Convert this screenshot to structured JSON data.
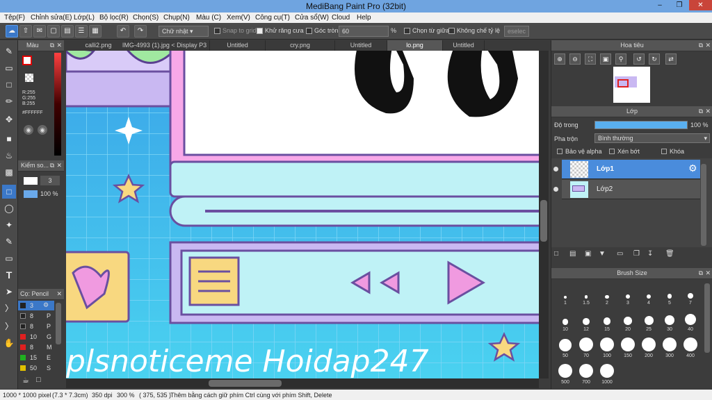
{
  "window": {
    "title": "MediBang Paint Pro (32bit)"
  },
  "menu": [
    "Tệp(F)",
    "Chỉnh sửa(E)",
    "Lớp(L)",
    "Bộ lọc(R)",
    "Chọn(S)",
    "Chụp(N)",
    "Màu (C)",
    "Xem(V)",
    "Công cụ(T)",
    "Cửa sổ(W)",
    "Cloud",
    "Help"
  ],
  "toolbar": {
    "shape_select": "Chữ nhật",
    "snap_label": "Snap to grid",
    "antialias_label": "Khử răng cưa",
    "corner_label": "Góc tròn",
    "corner_value": "60",
    "percent": "%",
    "center_label": "Chọn từ giữa",
    "ratio_label": "Không chế tỷ lệ",
    "deselect_label": "eselec"
  },
  "tabs": [
    "calli2.png",
    "IMG-4993 (1).jpg < Display P3 >",
    "Untitled",
    "cry.png",
    "Untitled",
    "lo.png",
    "Untitled"
  ],
  "color_panel": {
    "title": "Màu",
    "r": "R:255",
    "g": "G:255",
    "b": "B:255",
    "hex": "#FFFFFF",
    "fg": "#ffffff",
    "bg": "#e00000"
  },
  "brush_ctrl": {
    "title": "Kiểm so...",
    "size": "3",
    "opacity": "100 %"
  },
  "brush_list": {
    "title": "Cọ: Pencil",
    "items": [
      {
        "size": "3",
        "name": "",
        "color": "#222222"
      },
      {
        "size": "8",
        "name": "P",
        "color": "#222222"
      },
      {
        "size": "8",
        "name": "P",
        "color": "#222222"
      },
      {
        "size": "10",
        "name": "G",
        "color": "#e02020"
      },
      {
        "size": "8",
        "name": "M",
        "color": "#e02020"
      },
      {
        "size": "15",
        "name": "E",
        "color": "#20b020"
      },
      {
        "size": "50",
        "name": "S",
        "color": "#e0c000"
      }
    ]
  },
  "navigator": {
    "title": "Hoa tiêu"
  },
  "layer_panel": {
    "title": "Lớp",
    "opacity_label": "Độ trong",
    "opacity_value": "100 %",
    "opacity": 1.0,
    "blend_label": "Pha trộn",
    "blend_value": "Bình thường",
    "protect_alpha": "Bảo vệ alpha",
    "clip": "Xén bớt",
    "lock": "Khóa",
    "layers": [
      "Lớp1",
      "Lớp2"
    ]
  },
  "brush_size": {
    "title": "Brush Size",
    "sizes": [
      "1",
      "1.5",
      "2",
      "3",
      "4",
      "5",
      "7",
      "10",
      "12",
      "15",
      "20",
      "25",
      "30",
      "40",
      "50",
      "70",
      "100",
      "150",
      "200",
      "300",
      "400",
      "500",
      "700",
      "1000"
    ]
  },
  "canvas": {
    "text": "plsnoticeme Hoidap247"
  },
  "status": {
    "size": "1000 * 1000 pixel",
    "cm": "(7.3 * 7.3cm)",
    "dpi": "350 dpi",
    "zoom": "300 %",
    "coords": "( 375, 535 )",
    "hint": "Thêm bằng cách giữ phím Ctrl cùng với phím Shift, Delete"
  }
}
